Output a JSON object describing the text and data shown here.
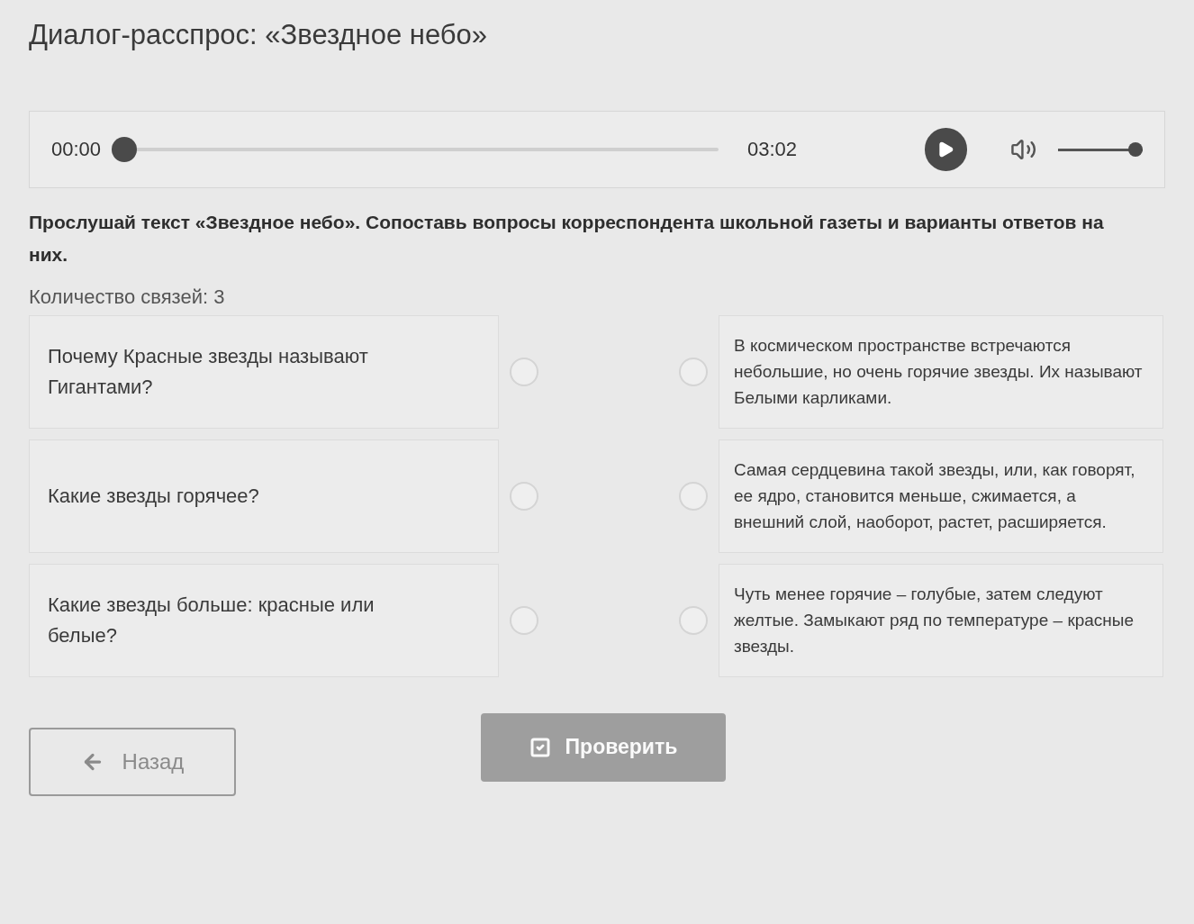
{
  "title": "Диалог-расспрос: «Звездное небо»",
  "player": {
    "current_time": "00:00",
    "duration": "03:02",
    "level": 0,
    "volume": {
      "level": 1
    }
  },
  "instruction": "Прослушай текст «Звездное небо». Сопоставь вопросы корреспондента школьной газеты и варианты ответов на них.",
  "connections_count": "Количество связей: 3",
  "questions": [
    {
      "text": "Почему Красные звезды называют Гигантами?",
      "selected": false
    },
    {
      "text": "Какие звезды горячее?",
      "selected": false
    },
    {
      "text": "Какие звезды больше: красные или белые?",
      "selected": false
    }
  ],
  "answers": [
    {
      "text": "В космическом пространстве встречаются небольшие, но очень горячие звезды. Их называют Белыми карликами.",
      "selected": false
    },
    {
      "text": "Самая сердцевина такой звезды, или, как говорят, ее ядро, становится меньше, сжимается, а внешний слой, наоборот, растет, расширяется.",
      "selected": false
    },
    {
      "text": "Чуть менее горячие – голубые, затем следуют желтые. Замыкают ряд по температуре – красные звезды.",
      "selected": false
    }
  ],
  "buttons": [
    {
      "label": "Назад",
      "kind": "back",
      "disabled": false
    },
    {
      "label": "Проверить",
      "kind": "check",
      "disabled": true
    }
  ]
}
